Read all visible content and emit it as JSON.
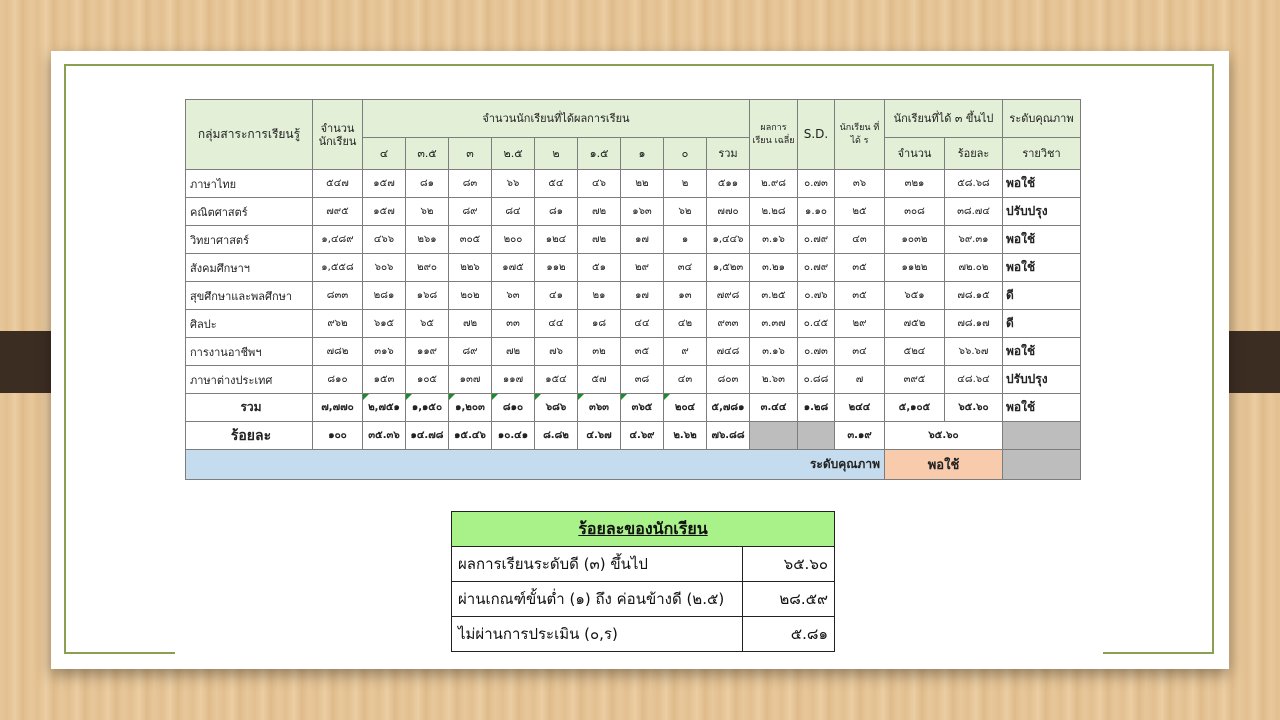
{
  "grade_table": {
    "headers": {
      "subject_group": "กลุ่มสาระการเรียนรู้",
      "student_count": "จำนวน นักเรียน",
      "grade_distribution": "จำนวนนักเรียนที่ได้ผลการเรียน",
      "mean_grade": "ผลการ เรียน เฉลี่ย",
      "sd": "S.D.",
      "students_r": "นักเรียน ที่ได้ ร",
      "three_up": "นักเรียนที่ได้ ๓ ขึ้นไป",
      "count": "จำนวน",
      "percent": "ร้อยละ",
      "quality_level": "ระดับคุณภาพ",
      "per_subject": "รายวิชา",
      "grades": [
        "๔",
        "๓.๕",
        "๓",
        "๒.๕",
        "๒",
        "๑.๕",
        "๑",
        "๐",
        "รวม"
      ]
    },
    "rows": [
      {
        "subject": "ภาษาไทย",
        "students": "๕๔๗",
        "grades": [
          "๑๕๗",
          "๘๑",
          "๘๓",
          "๖๖",
          "๕๔",
          "๔๖",
          "๒๒",
          "๒",
          "๕๑๑"
        ],
        "mean": "๒.๙๘",
        "sd": "๐.๗๓",
        "r": "๓๖",
        "count3": "๓๒๑",
        "pct3": "๕๘.๖๘",
        "quality": "พอใช้"
      },
      {
        "subject": "คณิตศาสตร์",
        "students": "๗๙๕",
        "grades": [
          "๑๕๗",
          "๖๒",
          "๘๙",
          "๘๔",
          "๘๑",
          "๗๒",
          "๑๖๓",
          "๖๒",
          "๗๗๐"
        ],
        "mean": "๒.๒๘",
        "sd": "๑.๑๐",
        "r": "๒๕",
        "count3": "๓๐๘",
        "pct3": "๓๘.๗๔",
        "quality": "ปรับปรุง"
      },
      {
        "subject": "วิทยาศาสตร์",
        "students": "๑,๔๘๙",
        "grades": [
          "๔๖๖",
          "๒๖๑",
          "๓๐๕",
          "๒๐๐",
          "๑๒๔",
          "๗๒",
          "๑๗",
          "๑",
          "๑,๔๔๖"
        ],
        "mean": "๓.๑๖",
        "sd": "๐.๗๙",
        "r": "๔๓",
        "count3": "๑๐๓๒",
        "pct3": "๖๙.๓๑",
        "quality": "พอใช้"
      },
      {
        "subject": "สังคมศึกษาฯ",
        "students": "๑,๕๕๘",
        "grades": [
          "๖๐๖",
          "๒๙๐",
          "๒๒๖",
          "๑๗๕",
          "๑๑๒",
          "๕๑",
          "๒๙",
          "๓๔",
          "๑,๕๒๓"
        ],
        "mean": "๓.๒๑",
        "sd": "๐.๗๙",
        "r": "๓๕",
        "count3": "๑๑๒๒",
        "pct3": "๗๒.๐๒",
        "quality": "พอใช้"
      },
      {
        "subject": "สุขศึกษาและพลศึกษา",
        "students": "๘๓๓",
        "grades": [
          "๒๘๑",
          "๑๖๘",
          "๒๐๒",
          "๖๓",
          "๔๑",
          "๒๑",
          "๑๗",
          "๑๓",
          "๗๙๘"
        ],
        "mean": "๓.๒๕",
        "sd": "๐.๗๖",
        "r": "๓๕",
        "count3": "๖๕๑",
        "pct3": "๗๘.๑๕",
        "quality": "ดี"
      },
      {
        "subject": "ศิลปะ",
        "students": "๙๖๒",
        "grades": [
          "๖๑๕",
          "๖๕",
          "๗๒",
          "๓๓",
          "๔๔",
          "๑๘",
          "๔๔",
          "๔๒",
          "๙๓๓"
        ],
        "mean": "๓.๓๗",
        "sd": "๐.๔๕",
        "r": "๒๙",
        "count3": "๗๕๒",
        "pct3": "๗๘.๑๗",
        "quality": "ดี"
      },
      {
        "subject": "การงานอาชีพฯ",
        "students": "๗๘๒",
        "grades": [
          "๓๑๖",
          "๑๑๙",
          "๘๙",
          "๗๒",
          "๗๖",
          "๓๒",
          "๓๕",
          "๙",
          "๗๔๘"
        ],
        "mean": "๓.๑๖",
        "sd": "๐.๗๓",
        "r": "๓๔",
        "count3": "๕๒๔",
        "pct3": "๖๖.๖๗",
        "quality": "พอใช้"
      },
      {
        "subject": "ภาษาต่างประเทศ",
        "students": "๘๑๐",
        "grades": [
          "๑๕๓",
          "๑๐๕",
          "๑๓๗",
          "๑๑๗",
          "๑๕๔",
          "๕๗",
          "๓๘",
          "๔๓",
          "๘๐๓"
        ],
        "mean": "๒.๖๓",
        "sd": "๐.๘๘",
        "r": "๗",
        "count3": "๓๙๕",
        "pct3": "๔๘.๖๔",
        "quality": "ปรับปรุง"
      }
    ],
    "total": {
      "label": "รวม",
      "students": "๗,๗๗๐",
      "grades": [
        "๒,๗๕๑",
        "๑,๑๕๐",
        "๑,๒๐๓",
        "๘๑๐",
        "๖๘๖",
        "๓๖๓",
        "๓๖๕",
        "๒๐๔",
        "๕,๗๘๑"
      ],
      "mean": "๓.๔๔",
      "sd": "๑.๒๘",
      "r": "๒๔๔",
      "count3": "๕,๑๐๕",
      "pct3": "๖๕.๖๐",
      "quality": "พอใช้"
    },
    "percent_row": {
      "label": "ร้อยละ",
      "students": "๑๐๐",
      "grades": [
        "๓๕.๓๖",
        "๑๔.๗๘",
        "๑๕.๔๖",
        "๑๐.๔๑",
        "๘.๘๒",
        "๔.๖๗",
        "๔.๖๙",
        "๒.๖๒",
        "๗๖.๘๘"
      ],
      "mean_avg": "๓.๑๙",
      "pct3": "๖๕.๖๐"
    },
    "quality_row": {
      "label": "ระดับคุณภาพ",
      "value": "พอใช้"
    }
  },
  "summary": {
    "title": "ร้อยละของนักเรียน",
    "rows": [
      {
        "label": "ผลการเรียนระดับดี (๓) ขึ้นไป",
        "value": "๖๕.๖๐"
      },
      {
        "label": "ผ่านเกณฑ์ขั้นต่ำ (๑) ถึง ค่อนข้างดี (๒.๕)",
        "value": "๒๘.๕๙"
      },
      {
        "label": "ไม่ผ่านการประเมิน (๐,ร)",
        "value": "๕.๘๑"
      }
    ]
  },
  "colors": {
    "header_bg": "#e3efd6",
    "quality_band": "#c5dcef",
    "quality_value": "#f8cbad",
    "summary_header": "#a9f28a",
    "frame_border": "#8aa050"
  }
}
